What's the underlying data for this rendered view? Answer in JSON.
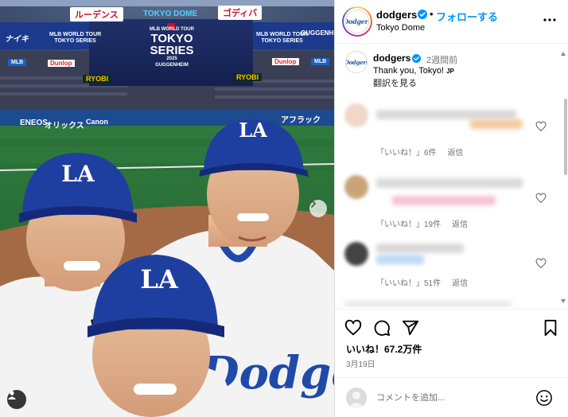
{
  "photo": {
    "banner_ads": [
      "ルーデンス",
      "TOKYO DOME",
      "ゴディバ"
    ],
    "board_left_text": "ナイキ",
    "board_left_series": "MLB WORLD TOUR\nTOKYO SERIES",
    "board_right_series": "MLB WORLD TOUR\nTOKYO SERIES",
    "board_right_text": "GUGGENHEIM",
    "board_center": {
      "line1": "MLB WORLD TOUR",
      "line2": "TOKYO",
      "line3": "SERIES",
      "line4": "2025",
      "line5": "GUGGENHEIM"
    },
    "ribbon_left": "MLB",
    "ribbon_right": "MLB",
    "ad_dunlop": "Dunlop",
    "ad_ryobi": "RYOBI",
    "wall_ads": [
      "ENEOS",
      "オリックス",
      "Canon",
      "アフラック"
    ],
    "cap_letters": "LA",
    "jersey_text": "Dodgers",
    "carousel_next_glyph": "›"
  },
  "header": {
    "username": "dodgers",
    "separator": "•",
    "follow_label": "フォローする",
    "location": "Tokyo Dome",
    "avatar_text": "Dodgers"
  },
  "caption": {
    "username": "dodgers",
    "time": "2週間前",
    "text": "Thank you, Tokyo!",
    "lang_badge": "JP",
    "translate_label": "翻訳を見る"
  },
  "comments": [
    {
      "likes_label": "「いいね！」6件",
      "reply_label": "返信",
      "avatar_color": "#f0d7c8",
      "bar_colors": [
        "#d9d9d9",
        "#f3c99e"
      ]
    },
    {
      "likes_label": "「いいね！」19件",
      "reply_label": "返信",
      "avatar_color": "#c9a37a",
      "bar_colors": [
        "#d9d9d9",
        "#f6c2d4"
      ]
    },
    {
      "likes_label": "「いいね！」51件",
      "reply_label": "返信",
      "avatar_color": "#444444",
      "bar_colors": [
        "#d9d9d9",
        "#bcd9f6"
      ]
    }
  ],
  "actions": {
    "likes_text": "いいね！67.2万件",
    "date": "3月19日"
  },
  "comment_input": {
    "placeholder": "コメントを追加..."
  },
  "colors": {
    "link_blue": "#0095f6",
    "verified_blue": "#0095f6",
    "dodger_blue": "#1f4aa8",
    "meta_gray": "#737373"
  },
  "icons": {
    "more": "more-horizontal-icon",
    "heart": "heart-icon",
    "comment": "comment-icon",
    "share": "share-icon",
    "save": "bookmark-icon",
    "emoji": "emoji-icon",
    "user_tag": "user-tag-icon",
    "next": "chevron-right-icon"
  }
}
